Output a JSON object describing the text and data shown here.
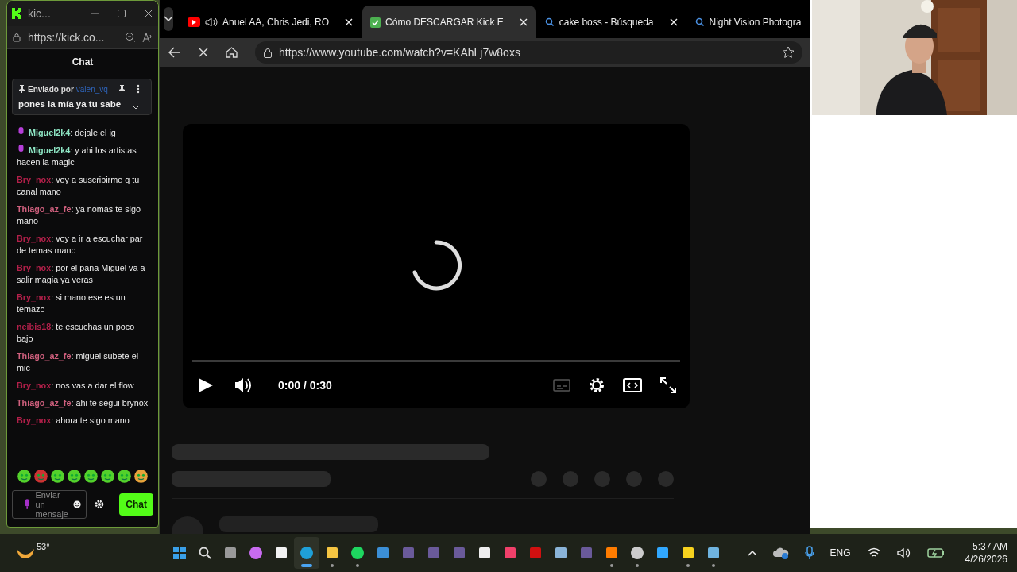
{
  "chat_window": {
    "title": "kic...",
    "url": "https://kick.co...",
    "header": "Chat",
    "pinned": {
      "prefix": "Enviado por",
      "user": "valen_vq",
      "message": "pones la mía ya tu sabe"
    },
    "messages": [
      {
        "user": "Miguel2k4",
        "text": ": dejale el ig",
        "color": "#8ee6c4",
        "badge": true
      },
      {
        "user": "Miguel2k4",
        "text": ": y ahi los artistas hacen la magic",
        "color": "#8ee6c4",
        "badge": true
      },
      {
        "user": "Bry_nox",
        "text": ": voy a suscribirme q tu canal mano",
        "color": "#b3204a",
        "badge": false
      },
      {
        "user": "Thiago_az_fe",
        "text": ": ya nomas te sigo mano",
        "color": "#d0607e",
        "badge": false
      },
      {
        "user": "Bry_nox",
        "text": ": voy a ir a escuchar par de temas mano",
        "color": "#b3204a",
        "badge": false
      },
      {
        "user": "Bry_nox",
        "text": ": por el pana Miguel va a salir magia ya veras",
        "color": "#b3204a",
        "badge": false
      },
      {
        "user": "Bry_nox",
        "text": ": si mano ese es un temazo",
        "color": "#b3204a",
        "badge": false
      },
      {
        "user": "neibis18",
        "text": ": te escuchas un poco bajo",
        "color": "#b3204a",
        "badge": false
      },
      {
        "user": "Thiago_az_fe",
        "text": ": miguel subete el mic",
        "color": "#d0607e",
        "badge": false
      },
      {
        "user": "Bry_nox",
        "text": ": nos vas a dar el flow",
        "color": "#b3204a",
        "badge": false
      },
      {
        "user": "Thiago_az_fe",
        "text": ": ahi te segui brynox",
        "color": "#d0607e",
        "badge": false
      },
      {
        "user": "Bry_nox",
        "text": ": ahora te sigo mano",
        "color": "#b3204a",
        "badge": false
      }
    ],
    "input": {
      "placeholder": "Enviar un mensaje"
    },
    "send_button": "Chat"
  },
  "browser": {
    "tabs": [
      {
        "title": "Anuel AA, Chris Jedi, RO",
        "selected": false,
        "kind": "video",
        "close_button": true
      },
      {
        "title": "Cómo DESCARGAR Kick E",
        "selected": true,
        "kind": "check",
        "close_button": true
      },
      {
        "title": "cake boss - Búsqueda",
        "selected": false,
        "kind": "search",
        "close_button": true
      },
      {
        "title": "Night Vision Photogra",
        "selected": false,
        "kind": "search",
        "close_button": false
      }
    ],
    "url": "https://www.youtube.com/watch?v=KAhLj7w8oxs",
    "player": {
      "time": "0:00 / 0:30",
      "level": 0
    }
  },
  "taskbar": {
    "weather": "53°",
    "apps": [
      {
        "kind": "start",
        "running": false,
        "selected": false
      },
      {
        "kind": "search",
        "running": false,
        "selected": false
      },
      {
        "kind": "taskview",
        "running": false,
        "selected": false
      },
      {
        "kind": "copilot",
        "running": false,
        "selected": false
      },
      {
        "kind": "store",
        "running": false,
        "selected": false
      },
      {
        "kind": "edge",
        "running": true,
        "selected": true
      },
      {
        "kind": "folder",
        "running": true,
        "selected": false
      },
      {
        "kind": "spotify",
        "running": true,
        "selected": false
      },
      {
        "kind": "shield",
        "running": false,
        "selected": false
      },
      {
        "kind": "app",
        "running": false,
        "selected": false
      },
      {
        "kind": "app",
        "running": false,
        "selected": false
      },
      {
        "kind": "app",
        "running": false,
        "selected": false
      },
      {
        "kind": "note",
        "running": false,
        "selected": false
      },
      {
        "kind": "music",
        "running": false,
        "selected": false
      },
      {
        "kind": "netflix",
        "running": false,
        "selected": false
      },
      {
        "kind": "calculator",
        "running": false,
        "selected": false
      },
      {
        "kind": "app",
        "running": false,
        "selected": false
      },
      {
        "kind": "illustrator",
        "running": true,
        "selected": false
      },
      {
        "kind": "obs",
        "running": true,
        "selected": false
      },
      {
        "kind": "photoshop",
        "running": false,
        "selected": false
      },
      {
        "kind": "sticky",
        "running": true,
        "selected": false
      },
      {
        "kind": "window",
        "running": true,
        "selected": false
      }
    ],
    "language": "ENG",
    "time": "5:37 AM",
    "date": "4/26/2026"
  }
}
